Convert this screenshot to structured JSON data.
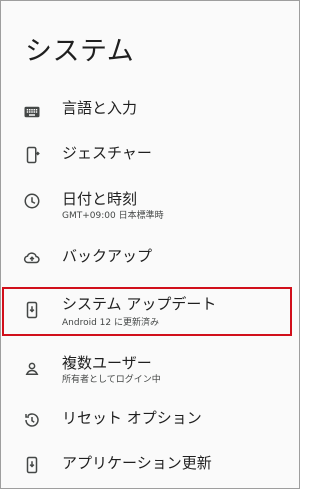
{
  "page": {
    "title": "システム"
  },
  "items": [
    {
      "label": "言語と入力",
      "icon": "keyboard-icon"
    },
    {
      "label": "ジェスチャー",
      "icon": "gesture-phone-icon"
    },
    {
      "label": "日付と時刻",
      "subtitle": "GMT+09:00 日本標準時",
      "icon": "clock-icon"
    },
    {
      "label": "バックアップ",
      "icon": "cloud-upload-icon"
    },
    {
      "label": "システム アップデート",
      "subtitle": "Android 12 に更新済み",
      "icon": "system-update-icon"
    },
    {
      "label": "複数ユーザー",
      "subtitle": "所有者としてログイン中",
      "icon": "person-icon"
    },
    {
      "label": "リセット オプション",
      "icon": "history-icon"
    },
    {
      "label": "アプリケーション更新",
      "icon": "app-update-icon"
    }
  ],
  "colors": {
    "highlight": "#d10f1b",
    "icon": "#444746",
    "text": "#1f1f1f"
  }
}
